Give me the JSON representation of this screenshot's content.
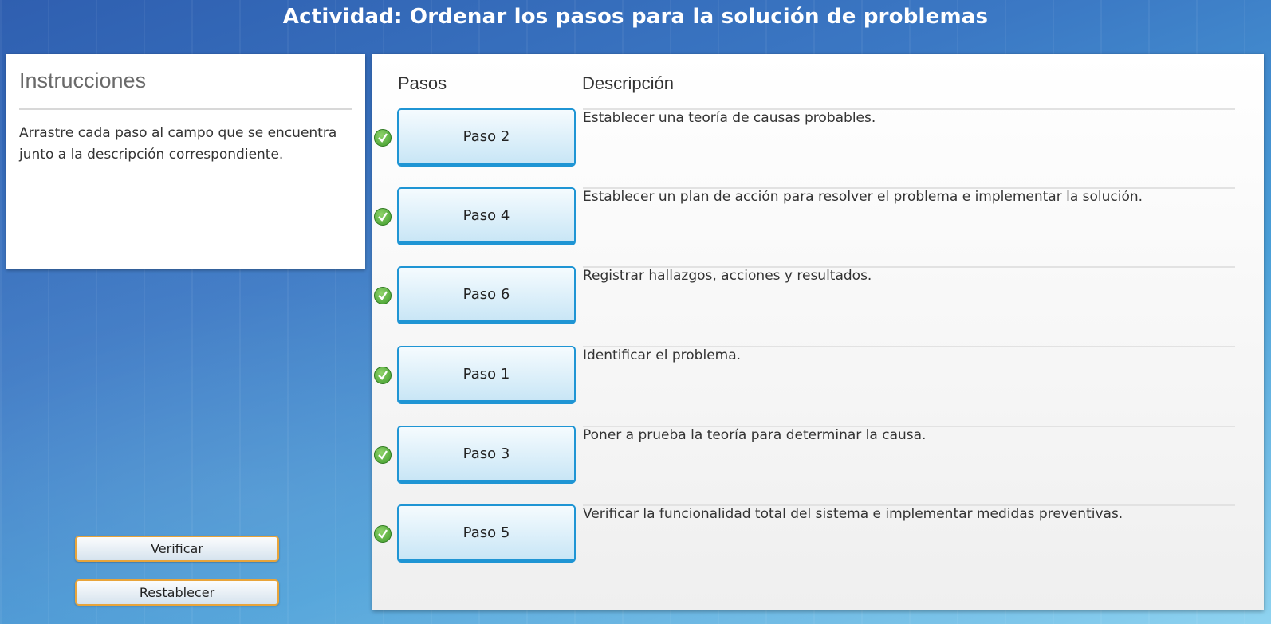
{
  "title": "Actividad: Ordenar los pasos para la solución de problemas",
  "instructions": {
    "heading": "Instrucciones",
    "text": "Arrastre cada paso al campo que se encuentra junto a la descripción correspondiente."
  },
  "buttons": {
    "verify": "Verificar",
    "reset": "Restablecer"
  },
  "table": {
    "col_steps": "Pasos",
    "col_description": "Descripción",
    "rows": [
      {
        "step": "Paso 2",
        "description": "Establecer una teoría de causas probables.",
        "correct": true
      },
      {
        "step": "Paso 4",
        "description": "Establecer un plan de acción para resolver el problema e implementar la solución.",
        "correct": true
      },
      {
        "step": "Paso 6",
        "description": "Registrar hallazgos, acciones y resultados.",
        "correct": true
      },
      {
        "step": "Paso 1",
        "description": "Identificar el problema.",
        "correct": true
      },
      {
        "step": "Paso 3",
        "description": "Poner a prueba la teoría para determinar la causa.",
        "correct": true
      },
      {
        "step": "Paso 5",
        "description": "Verificar la funcionalidad total del sistema e implementar medidas preventivas.",
        "correct": true
      }
    ]
  },
  "colors": {
    "step_border": "#1f95d4",
    "button_border": "#e8a43a",
    "check_green": "#3e9a2a"
  }
}
